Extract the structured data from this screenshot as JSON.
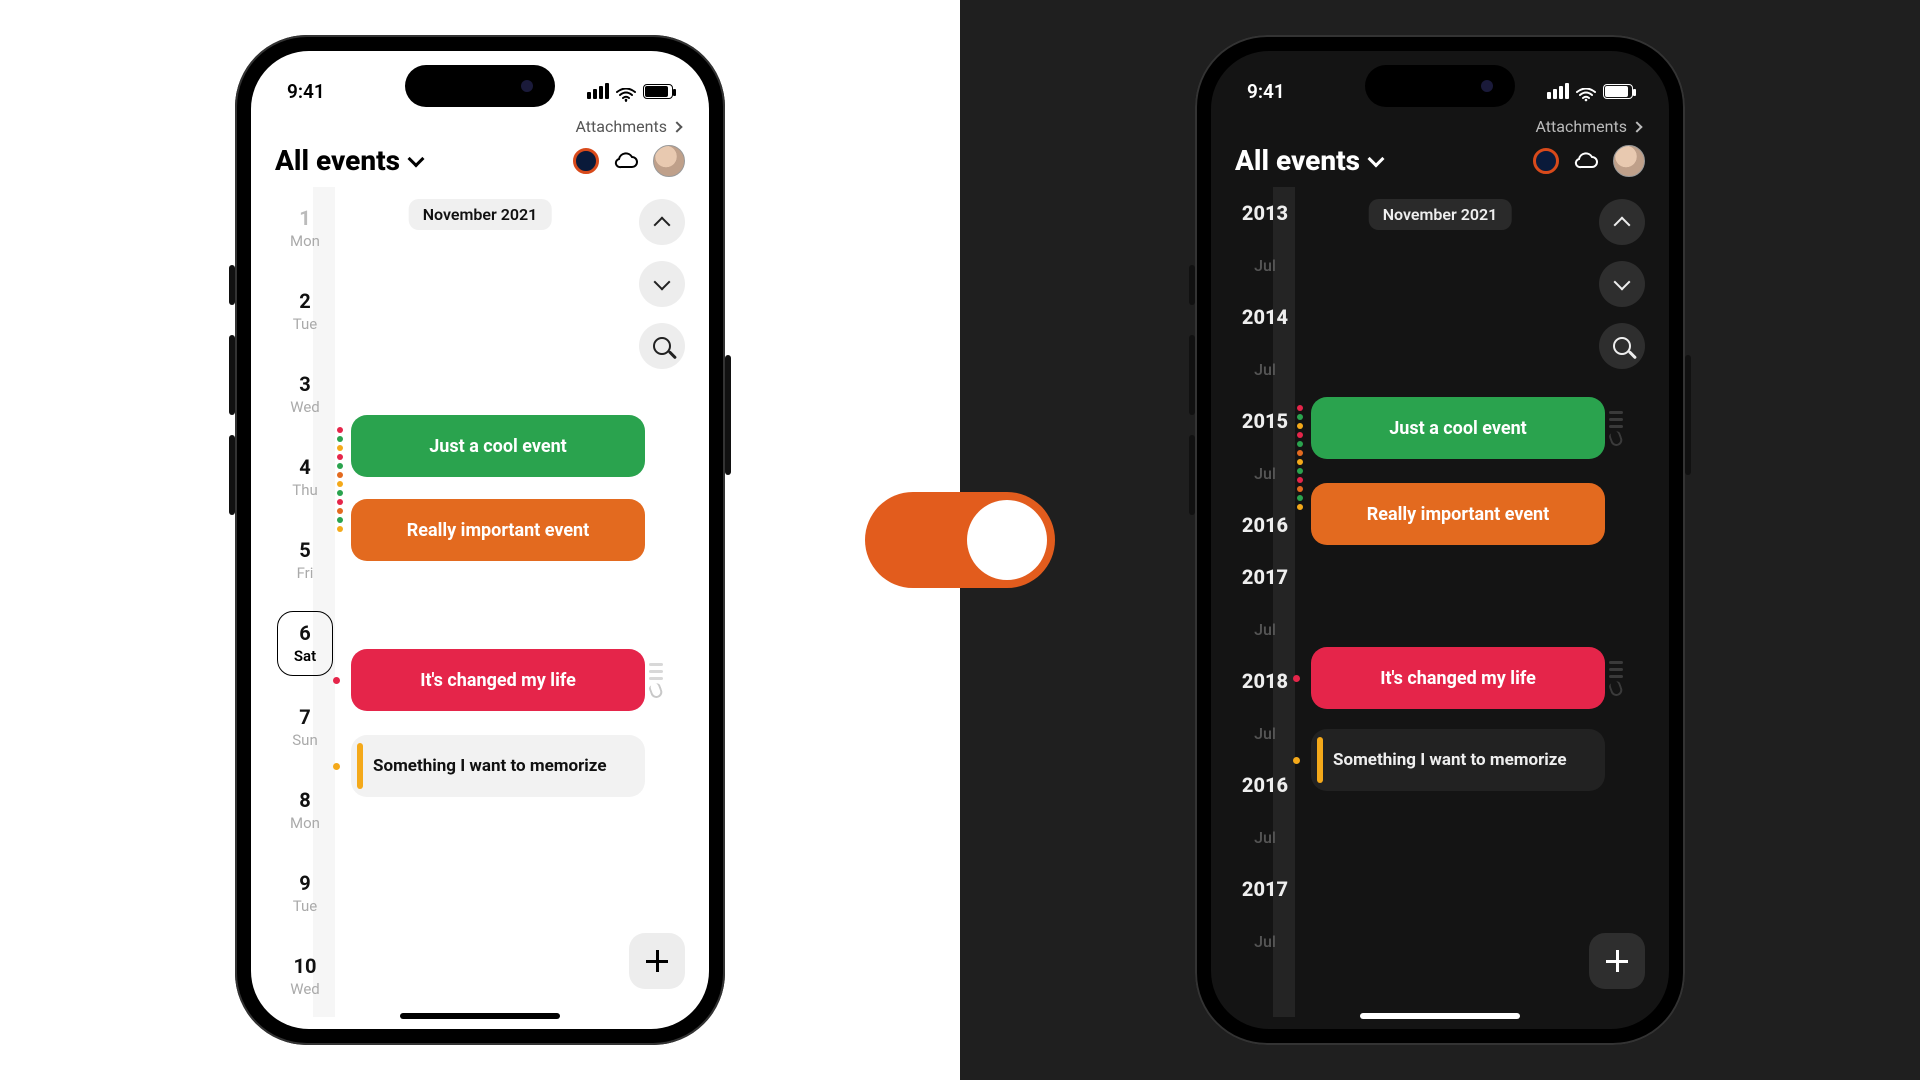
{
  "status": {
    "time": "9:41"
  },
  "attachments_label": "Attachments",
  "header": {
    "title": "All events"
  },
  "month_pill": "November 2021",
  "light_rail": [
    {
      "num": "1",
      "dow": "Mon",
      "dim": true
    },
    {
      "num": "2",
      "dow": "Tue"
    },
    {
      "num": "3",
      "dow": "Wed"
    },
    {
      "num": "4",
      "dow": "Thu"
    },
    {
      "num": "5",
      "dow": "Fri"
    },
    {
      "num": "6",
      "dow": "Sat",
      "today": true
    },
    {
      "num": "7",
      "dow": "Sun"
    },
    {
      "num": "8",
      "dow": "Mon"
    },
    {
      "num": "9",
      "dow": "Tue"
    },
    {
      "num": "10",
      "dow": "Wed"
    }
  ],
  "dark_rail": [
    "2013",
    "Jul",
    "2014",
    "Jul",
    "2015",
    "Jul",
    "2016",
    "2017",
    "Jul",
    "2018",
    "Jul",
    "2016",
    "Jul",
    "2017",
    "Jul"
  ],
  "events": {
    "green": "Just a cool event",
    "orange": "Really important event",
    "red": "It's changed my life",
    "memo": "Something I want to memorize"
  },
  "colors": {
    "green": "#2aa34e",
    "orange": "#e36a1f",
    "red": "#e5254a",
    "amber": "#f4a91a",
    "toggle": "#e25c1d"
  }
}
